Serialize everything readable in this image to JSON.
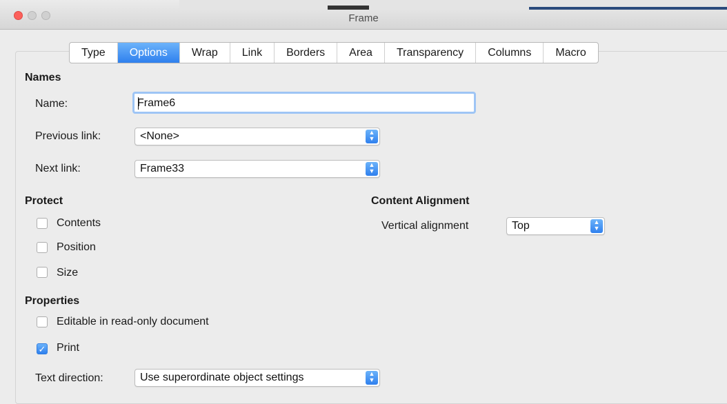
{
  "window": {
    "title": "Frame"
  },
  "tabs": [
    {
      "label": "Type",
      "active": false
    },
    {
      "label": "Options",
      "active": true
    },
    {
      "label": "Wrap",
      "active": false
    },
    {
      "label": "Link",
      "active": false
    },
    {
      "label": "Borders",
      "active": false
    },
    {
      "label": "Area",
      "active": false
    },
    {
      "label": "Transparency",
      "active": false
    },
    {
      "label": "Columns",
      "active": false
    },
    {
      "label": "Macro",
      "active": false
    }
  ],
  "names": {
    "title": "Names",
    "name_label": "Name:",
    "name_value": "Frame6",
    "previous_link_label": "Previous link:",
    "previous_link_value": "<None>",
    "next_link_label": "Next link:",
    "next_link_value": "Frame33"
  },
  "protect": {
    "title": "Protect",
    "contents": {
      "label": "Contents",
      "checked": false
    },
    "position": {
      "label": "Position",
      "checked": false
    },
    "size": {
      "label": "Size",
      "checked": false
    }
  },
  "content_alignment": {
    "title": "Content Alignment",
    "vertical_label": "Vertical alignment",
    "vertical_value": "Top"
  },
  "properties": {
    "title": "Properties",
    "editable": {
      "label": "Editable in read-only document",
      "checked": false
    },
    "print": {
      "label": "Print",
      "checked": true
    },
    "text_direction_label": "Text direction:",
    "text_direction_value": "Use superordinate object settings"
  },
  "colors": {
    "accent": "#2f80ee",
    "close_button": "#fc605b",
    "focus_ring": "#9ec5f5"
  },
  "icons": {
    "dropdown": "chevron-up-down-icon",
    "check": "checkmark-icon"
  }
}
